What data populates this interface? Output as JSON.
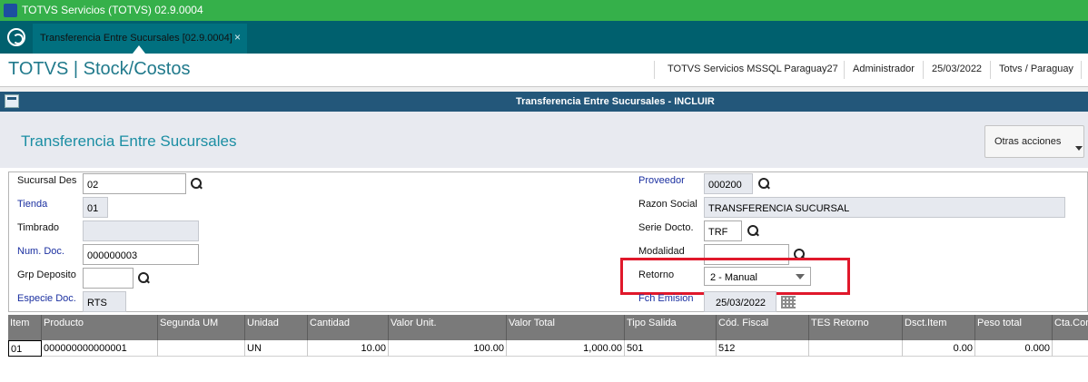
{
  "window": {
    "title": "TOTVS Servicios (TOTVS) 02.9.0004"
  },
  "tabs": [
    {
      "label": "Transferencia Entre Sucursales [02.9.0004]",
      "close": "×"
    }
  ],
  "header": {
    "brand": "TOTVS | Stock/Costos",
    "environment": "TOTVS Servicios MSSQL Paraguay27",
    "user": "Administrador",
    "date": "25/03/2022",
    "company": "Totvs / Paraguay"
  },
  "dialog": {
    "title": "Transferencia Entre Sucursales - INCLUIR",
    "form_title": "Transferencia Entre Sucursales",
    "actions_label": "Otras acciones"
  },
  "form": {
    "sucursal_des": {
      "label": "Sucursal Des",
      "value": "02"
    },
    "tienda": {
      "label": "Tienda",
      "value": "01"
    },
    "timbrado": {
      "label": "Timbrado",
      "value": ""
    },
    "num_doc": {
      "label": "Num. Doc.",
      "value": "000000003"
    },
    "grp_deposito": {
      "label": "Grp Deposito",
      "value": ""
    },
    "especie_doc": {
      "label": "Especie Doc.",
      "value": "RTS"
    },
    "proveedor": {
      "label": "Proveedor",
      "value": "000200"
    },
    "razon_social": {
      "label": "Razon Social",
      "value": "TRANSFERENCIA SUCURSAL"
    },
    "serie_docto": {
      "label": "Serie Docto.",
      "value": "TRF"
    },
    "modalidad": {
      "label": "Modalidad",
      "value": ""
    },
    "retorno": {
      "label": "Retorno",
      "value": "2 - Manual"
    },
    "fch_emision": {
      "label": "Fch Emision",
      "value": "25/03/2022"
    }
  },
  "grid": {
    "columns": [
      "Item",
      "Producto",
      "Segunda UM",
      "Unidad",
      "Cantidad",
      "Valor Unit.",
      "Valor Total",
      "Tipo Salida",
      "Cód. Fiscal",
      "TES Retorno",
      "Dsct.Item",
      "Peso total",
      "Cta.Con"
    ],
    "rows": [
      [
        "01",
        "000000000000001",
        "",
        "UN",
        "10.00",
        "100.00",
        "1,000.00",
        "501",
        "512",
        "",
        "0.00",
        "0.000",
        ""
      ]
    ]
  },
  "colors": {
    "titlebar": "#35b04a",
    "tabbar": "#00606e",
    "dialog_title": "#23577a",
    "brand": "#217a8c",
    "highlight": "#e0182b"
  }
}
